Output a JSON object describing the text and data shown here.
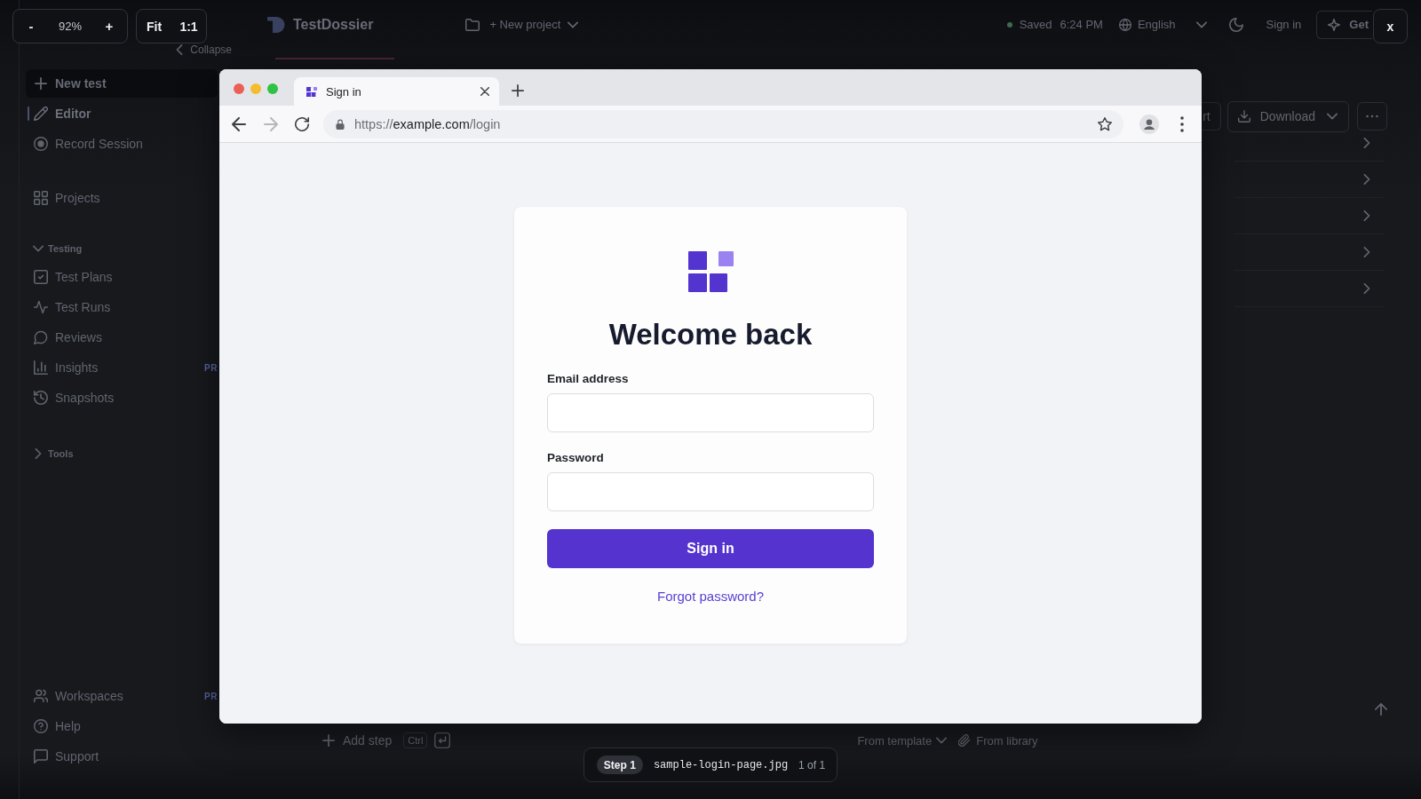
{
  "viewer": {
    "zoom_out": "-",
    "zoom_level": "92%",
    "zoom_in": "+",
    "fit": "Fit",
    "actual_size": "1:1",
    "close": "x"
  },
  "app_header": {
    "brand": "TestDossier",
    "new_project": "+ New project",
    "save_status": "Saved",
    "save_time": "6:24 PM",
    "language": "English",
    "sign_in": "Sign in",
    "partial_button": "Get"
  },
  "sidebar": {
    "collapse": "Collapse",
    "new_test": "New test",
    "nav_groups": [
      {
        "items": [
          {
            "label": "Editor",
            "selected": true
          },
          {
            "label": "Record Session",
            "selected": false
          }
        ]
      },
      {
        "items": [
          {
            "label": "Projects",
            "selected": false
          }
        ]
      }
    ],
    "sections": [
      {
        "title": "Testing",
        "expanded": true,
        "items": [
          {
            "label": "Test Plans",
            "selected": false
          },
          {
            "label": "Test Runs",
            "selected": false
          },
          {
            "label": "Reviews",
            "selected": false
          },
          {
            "label": "Insights",
            "selected": false,
            "badge": "PR"
          },
          {
            "label": "Snapshots",
            "selected": false
          }
        ]
      },
      {
        "title": "Tools",
        "expanded": false
      }
    ],
    "bottom_items": [
      {
        "label": "Workspaces",
        "selected": false,
        "badge": "PR"
      },
      {
        "label": "Help",
        "selected": false
      },
      {
        "label": "Support",
        "selected": false
      }
    ]
  },
  "toolbar": {
    "partial_button": "rt",
    "download": "Download"
  },
  "footer": {
    "add_step": "Add step",
    "shortcut": "Ctrl",
    "from_template": "From template",
    "from_library": "From library"
  },
  "image": {
    "browser": {
      "tabs": [
        {
          "title": "Sign in",
          "selected": true
        }
      ],
      "nav_buttons": [
        {
          "disabled": false
        },
        {
          "disabled": true
        },
        {
          "disabled": false
        }
      ],
      "url": {
        "scheme": "https://",
        "host": "example.com",
        "path": "/login"
      }
    },
    "login": {
      "heading": "Welcome back",
      "fields": [
        {
          "label": "Email address"
        },
        {
          "label": "Password"
        }
      ],
      "submit": "Sign in",
      "forgot_link": "Forgot password?"
    }
  },
  "caption": {
    "step": "Step 1",
    "filename": "sample-login-page.jpg",
    "counter": "1 of 1"
  }
}
